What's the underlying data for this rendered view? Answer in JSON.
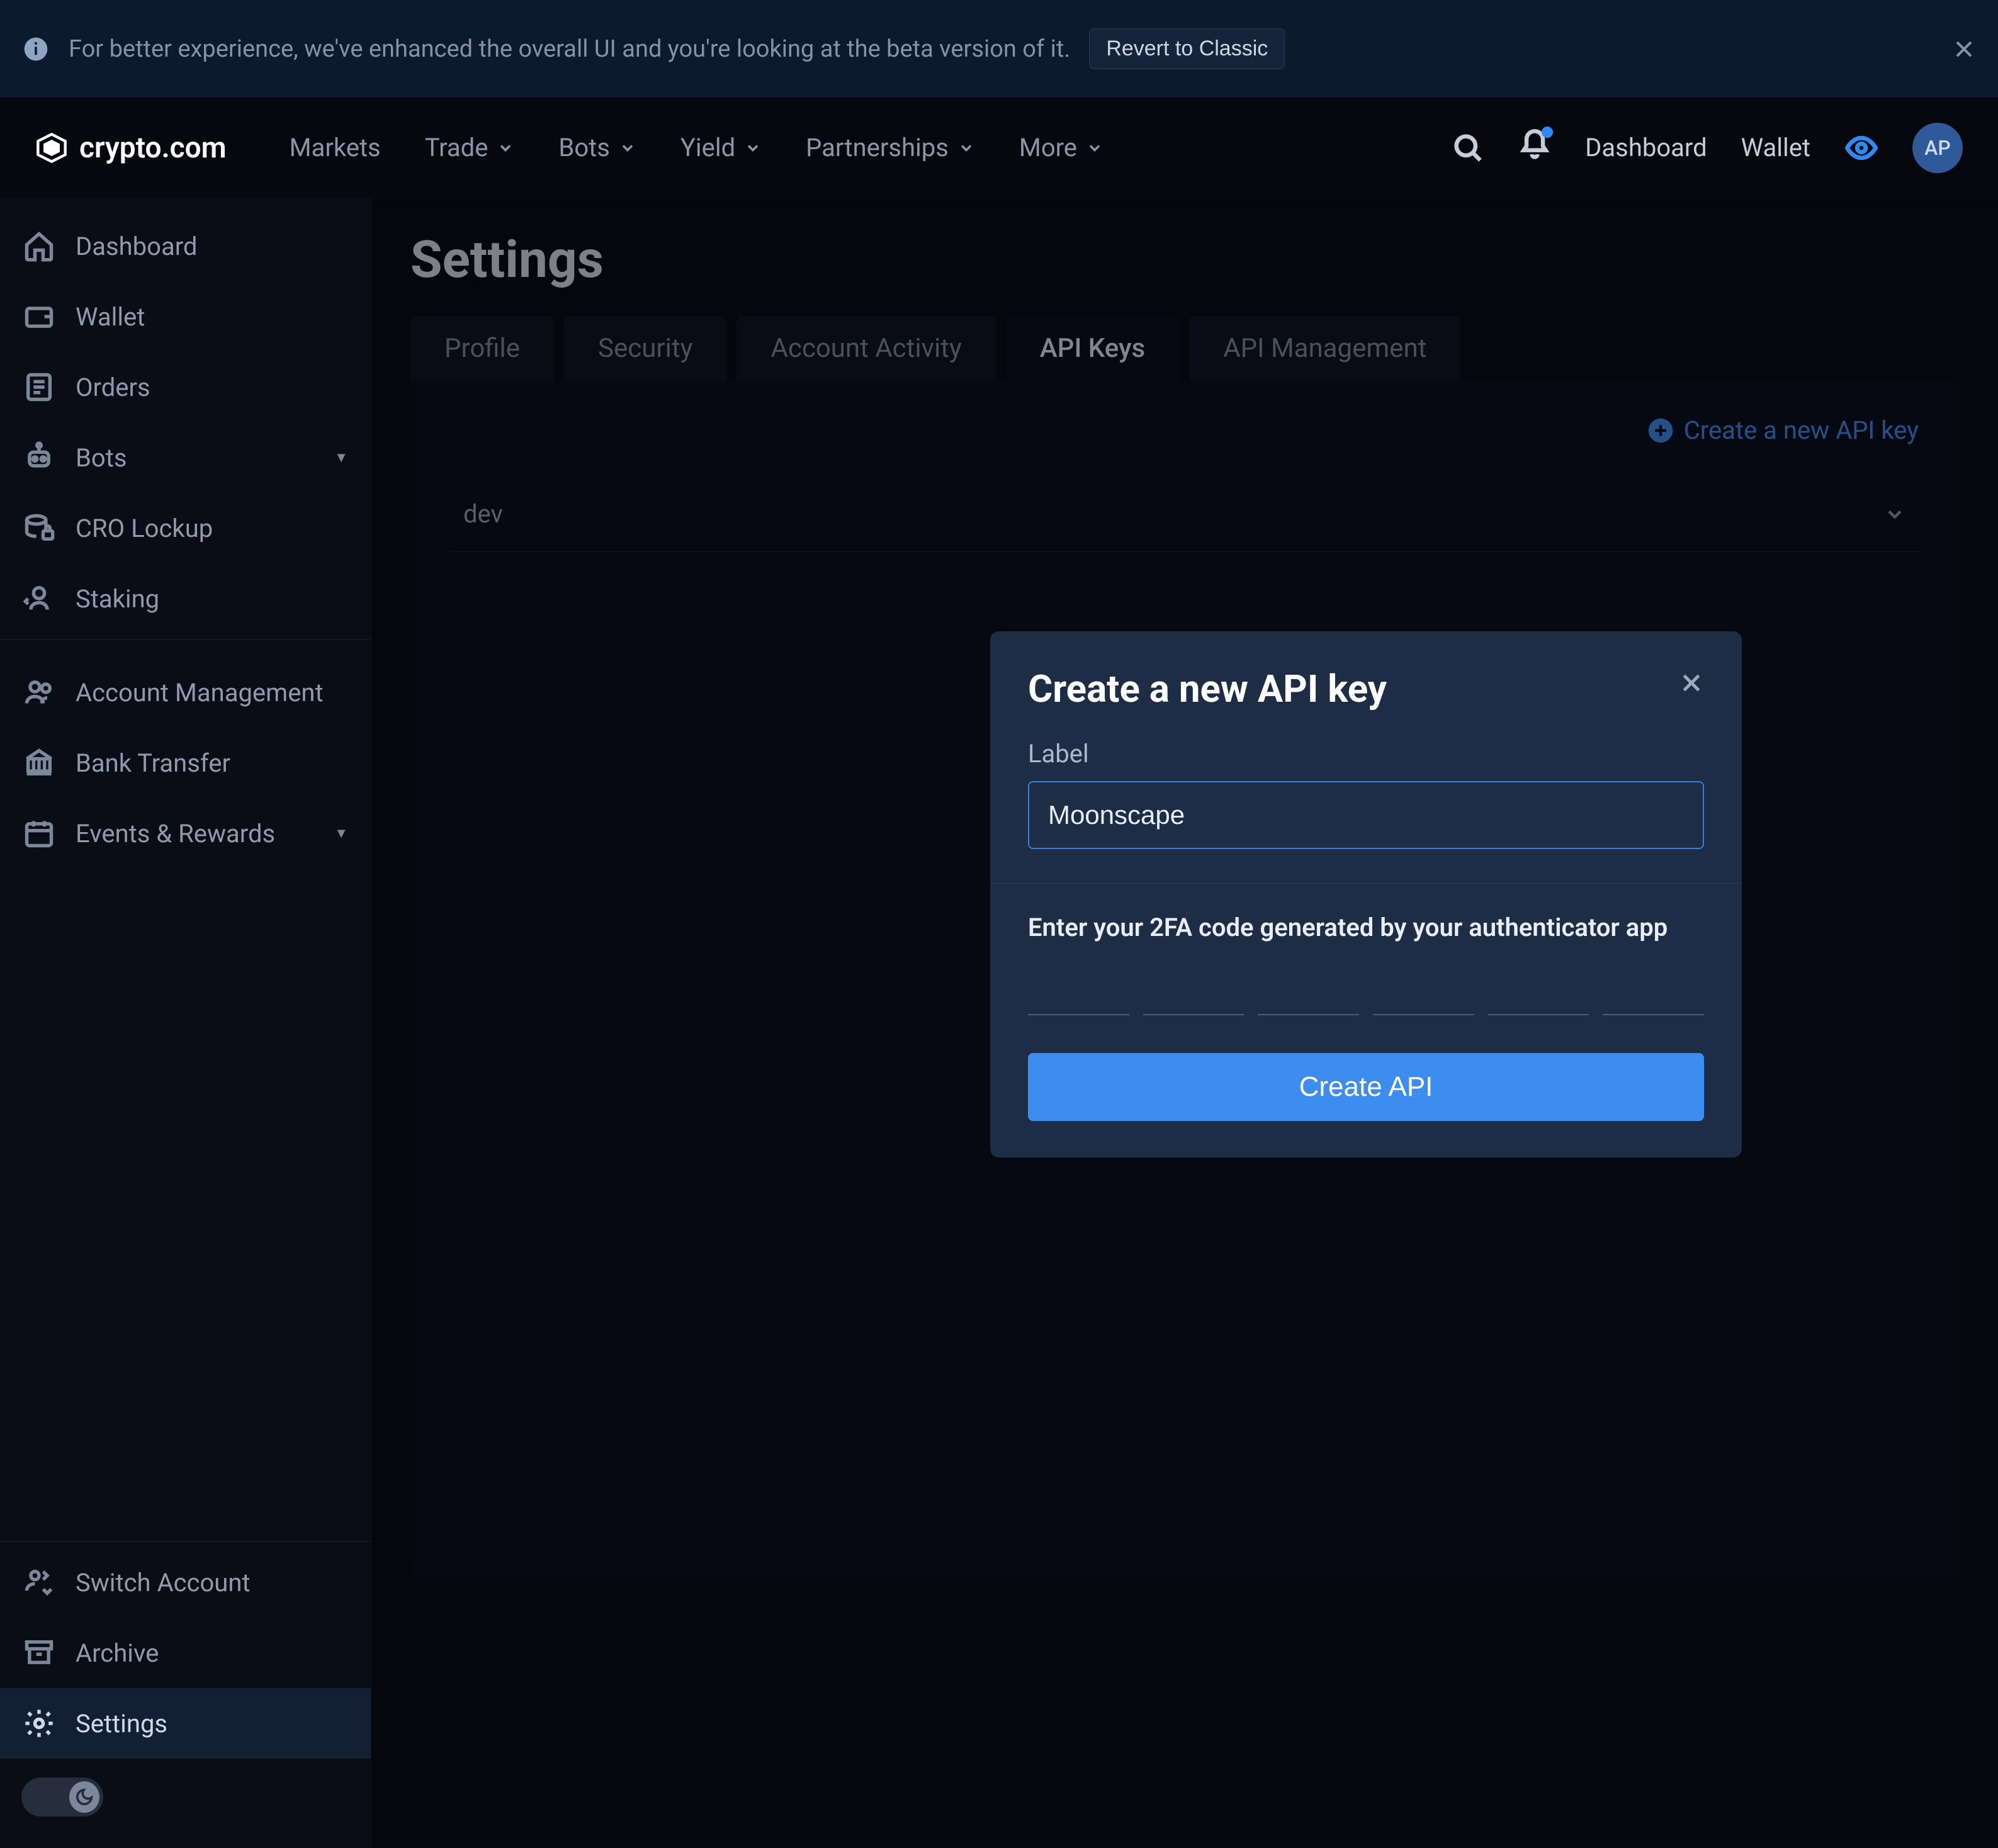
{
  "banner": {
    "text": "For better experience, we've enhanced the overall UI and you're looking at the beta version of it.",
    "revert_label": "Revert to Classic"
  },
  "brand": "crypto.com",
  "topnav": {
    "items": [
      "Markets",
      "Trade",
      "Bots",
      "Yield",
      "Partnerships",
      "More"
    ],
    "right": {
      "dashboard": "Dashboard",
      "wallet": "Wallet",
      "avatar_initials": "AP"
    }
  },
  "sidebar": {
    "primary": [
      {
        "label": "Dashboard",
        "icon": "home"
      },
      {
        "label": "Wallet",
        "icon": "wallet"
      },
      {
        "label": "Orders",
        "icon": "orders"
      },
      {
        "label": "Bots",
        "icon": "bot",
        "caret": true
      },
      {
        "label": "CRO Lockup",
        "icon": "db"
      },
      {
        "label": "Staking",
        "icon": "stake"
      }
    ],
    "secondary": [
      {
        "label": "Account Management",
        "icon": "accounts"
      },
      {
        "label": "Bank Transfer",
        "icon": "bank"
      },
      {
        "label": "Events & Rewards",
        "icon": "calendar",
        "caret": true
      }
    ],
    "footer": [
      {
        "label": "Switch Account",
        "icon": "switch"
      },
      {
        "label": "Archive",
        "icon": "archive"
      },
      {
        "label": "Settings",
        "icon": "gear",
        "active": true
      }
    ]
  },
  "page": {
    "title": "Settings",
    "tabs": [
      "Profile",
      "Security",
      "Account Activity",
      "API Keys",
      "API Management"
    ],
    "active_tab": 3,
    "create_link": "Create a new API key",
    "collapse_label": "dev"
  },
  "modal": {
    "title": "Create a new API key",
    "label_field": "Label",
    "label_value": "Moonscape",
    "tfa_prompt": "Enter your 2FA code generated by your authenticator app",
    "submit": "Create API"
  }
}
